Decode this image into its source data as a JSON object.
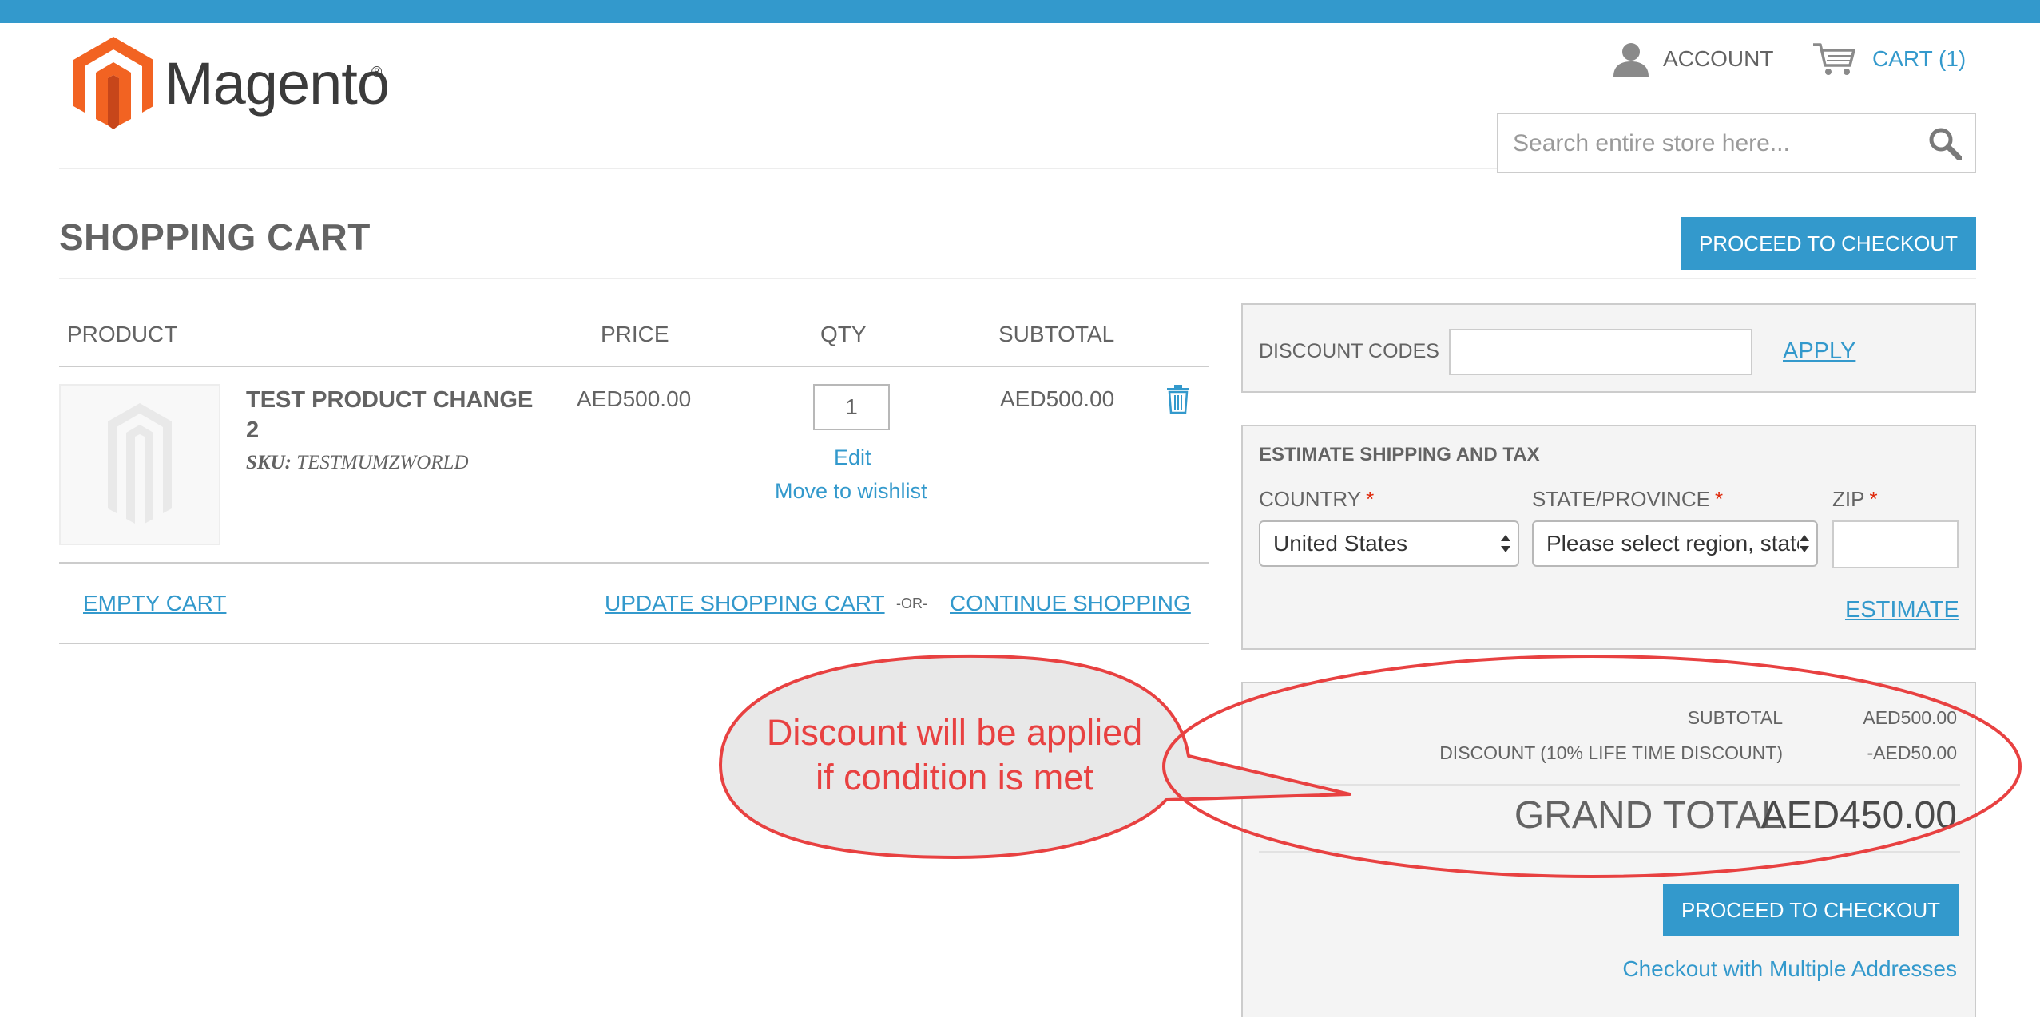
{
  "header": {
    "logo_text": "Magento",
    "logo_reg": "®",
    "account_label": "ACCOUNT",
    "cart_label": "CART (1)",
    "search_placeholder": "Search entire store here..."
  },
  "page": {
    "title": "SHOPPING CART",
    "checkout_label": "PROCEED TO CHECKOUT"
  },
  "cart": {
    "columns": [
      "PRODUCT",
      "PRICE",
      "QTY",
      "SUBTOTAL"
    ],
    "item": {
      "name": "TEST PRODUCT CHANGE 2",
      "sku_label": "SKU:",
      "sku": "TESTMUMZWORLD",
      "price": "AED500.00",
      "qty": "1",
      "subtotal": "AED500.00",
      "edit_label": "Edit",
      "wishlist_label": "Move to wishlist"
    },
    "empty_label": "EMPTY CART",
    "update_label": "UPDATE SHOPPING CART",
    "or_label": "-OR-",
    "continue_label": "CONTINUE SHOPPING"
  },
  "discount": {
    "label": "DISCOUNT CODES",
    "apply_label": "APPLY"
  },
  "shipping": {
    "title": "ESTIMATE SHIPPING AND TAX",
    "country_label": "COUNTRY",
    "state_label": "STATE/PROVINCE",
    "zip_label": "ZIP",
    "required_mark": "*",
    "country_value": "United States",
    "state_value": "Please select region, state",
    "estimate_label": "ESTIMATE"
  },
  "totals": {
    "subtotal_label": "SUBTOTAL",
    "subtotal_value": "AED500.00",
    "discount_label": "DISCOUNT (10% LIFE TIME DISCOUNT)",
    "discount_value": "-AED50.00",
    "grand_label": "GRAND TOTAL",
    "grand_value": "AED450.00",
    "checkout_label": "PROCEED TO CHECKOUT",
    "multi_label": "Checkout with Multiple Addresses"
  },
  "annotation": {
    "line1": "Discount will be applied",
    "line2": "if condition is met",
    "color": "#e84141"
  },
  "colors": {
    "accent": "#3399cc",
    "logo_orange": "#f26322",
    "required": "#df280a"
  }
}
